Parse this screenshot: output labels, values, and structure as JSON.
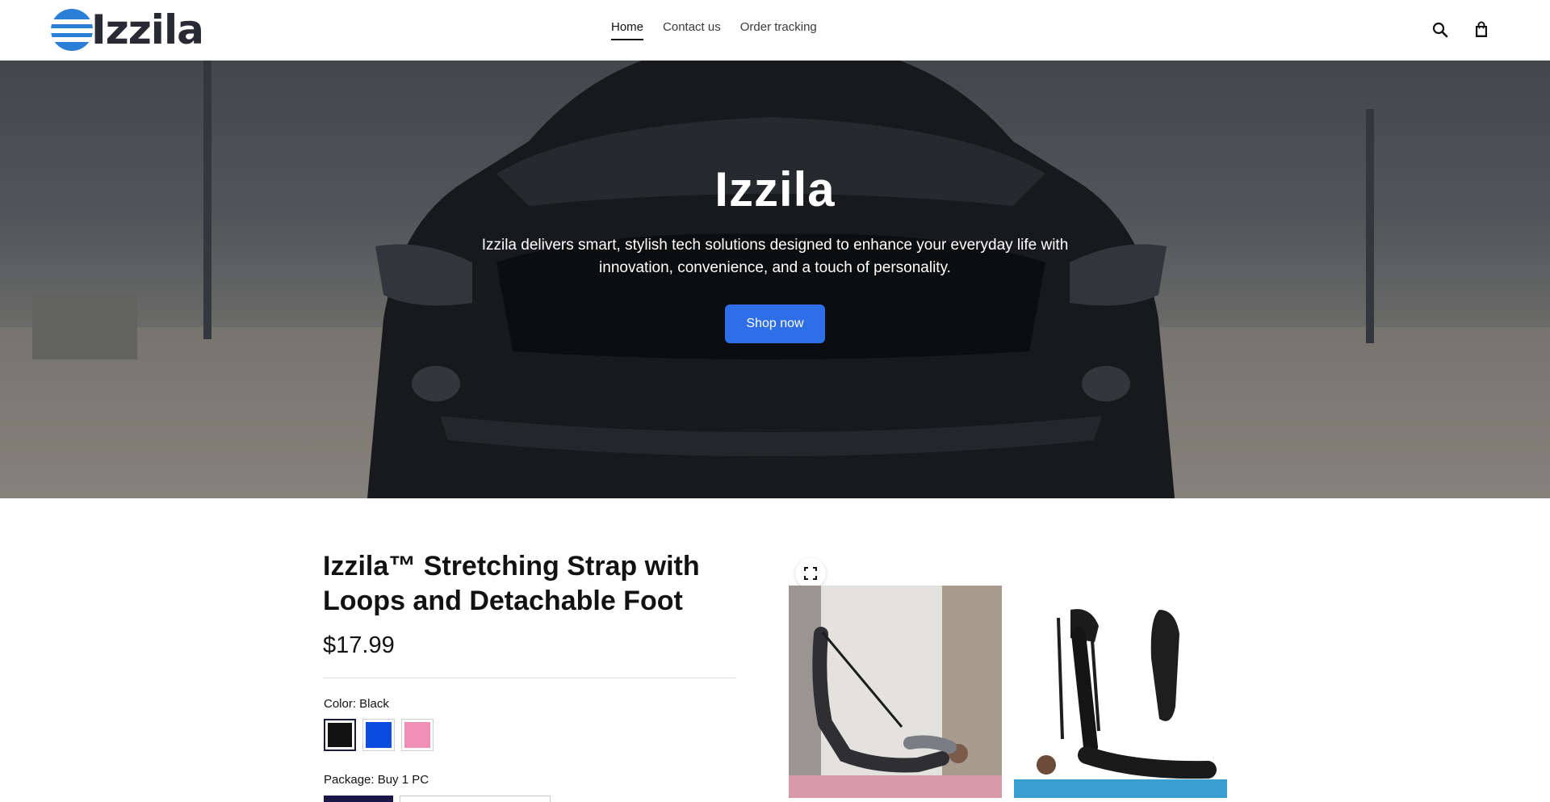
{
  "header": {
    "brand": "Izzila",
    "nav": [
      {
        "label": "Home",
        "active": true
      },
      {
        "label": "Contact us",
        "active": false
      },
      {
        "label": "Order tracking",
        "active": false
      }
    ],
    "icons": [
      "search-icon",
      "cart-icon"
    ]
  },
  "hero": {
    "title": "Izzila",
    "subtitle": "Izzila delivers smart, stylish tech solutions designed to enhance your everyday life with innovation, convenience, and a touch of personality.",
    "button_label": "Shop now"
  },
  "product": {
    "title": "Izzila™ Stretching Strap with Loops and Detachable Foot",
    "price": "$17.99",
    "color_label": "Color: Black",
    "colors": [
      {
        "name": "Black",
        "hex": "#121212",
        "selected": true
      },
      {
        "name": "Blue",
        "hex": "#0a4be0",
        "selected": false
      },
      {
        "name": "Pink",
        "hex": "#ef8fb6",
        "selected": false
      }
    ],
    "package_label": "Package: Buy 1 PC",
    "gallery": [
      "yoga-mat-strap-photo",
      "strap-product-photo"
    ]
  },
  "colors": {
    "accent": "#2e6ee6",
    "brand_blue": "#2b7fd6",
    "text": "#121212",
    "selected_package": "#1b1645"
  }
}
